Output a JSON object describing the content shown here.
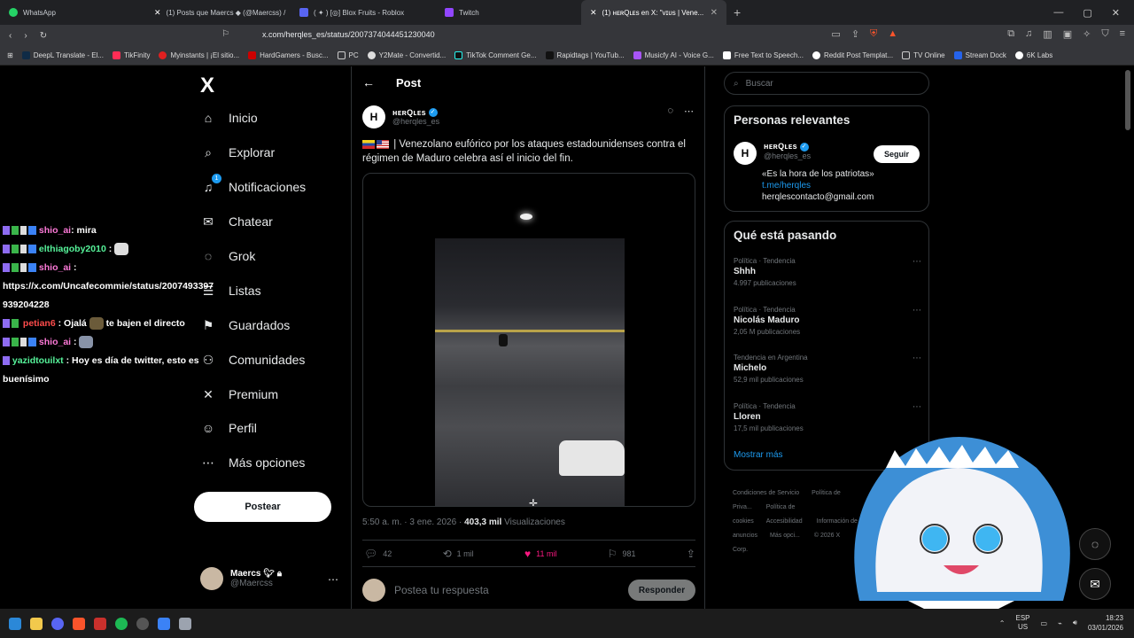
{
  "browser": {
    "tabs": [
      {
        "label": "WhatsApp",
        "color": "#25d366"
      },
      {
        "label": "(1) Posts que Maercs ◆ (@Maercss) /",
        "color": "#ffffff"
      },
      {
        "label": "( ✦ ) [◎] Blox Fruits - Roblox",
        "color": "#5865f2"
      },
      {
        "label": "Twitch",
        "color": "#9146ff"
      },
      {
        "label": "(1) ʜᴇʀQʟᴇs en X: \"vɪᴜs | Vene...",
        "color": "#ffffff"
      }
    ],
    "url": "x.com/herqles_es/status/2007374044451230040",
    "bookmarks": [
      "DeepL Translate - El...",
      "TikFinity",
      "Myinstants | ¡El sitio...",
      "HardGamers - Busc...",
      "PC",
      "Y2Mate - Convertid...",
      "TikTok Comment Ge...",
      "Rapidtags | YouTub...",
      "Musicfy AI - Voice G...",
      "Free Text to Speech...",
      "Reddit Post Templat...",
      "TV Online",
      "Stream Dock",
      "6K Labs"
    ]
  },
  "nav": {
    "logo": "X",
    "items": [
      {
        "label": "Inicio",
        "icon": "home-icon",
        "glyph": "⌂"
      },
      {
        "label": "Explorar",
        "icon": "search-icon",
        "glyph": "⌕"
      },
      {
        "label": "Notificaciones",
        "icon": "bell-icon",
        "glyph": "🔔︎",
        "badge": "1"
      },
      {
        "label": "Chatear",
        "icon": "mail-icon",
        "glyph": "✉"
      },
      {
        "label": "Grok",
        "icon": "grok-icon",
        "glyph": "◌"
      },
      {
        "label": "Listas",
        "icon": "list-icon",
        "glyph": "☰"
      },
      {
        "label": "Guardados",
        "icon": "bookmark-icon",
        "glyph": "⚑"
      },
      {
        "label": "Comunidades",
        "icon": "community-icon",
        "glyph": "⚇"
      },
      {
        "label": "Premium",
        "icon": "premium-icon",
        "glyph": "✕"
      },
      {
        "label": "Perfil",
        "icon": "profile-icon",
        "glyph": "☺"
      },
      {
        "label": "Más opciones",
        "icon": "more-icon",
        "glyph": "⋯"
      }
    ],
    "post_button": "Postear",
    "profile": {
      "name": "Maercs",
      "handle": "@Maercss"
    }
  },
  "chat": [
    {
      "user": "shio_ai",
      "color": "pink",
      "msg": ": mira"
    },
    {
      "user": "elthiagoby2010",
      "color": "green",
      "msg": ":"
    },
    {
      "user": "shio_ai",
      "color": "pink",
      "msg": ":"
    },
    {
      "user": "",
      "color": "",
      "msg": "https://x.com/Uncafecommie/status/2007493397939204228"
    },
    {
      "user": "petian6",
      "color": "red",
      "msg": ": Ojalá",
      "msg2": "te bajen el directo"
    },
    {
      "user": "shio_ai",
      "color": "pink",
      "msg": ":"
    },
    {
      "user": "yazidtouilxt",
      "color": "green",
      "msg": ": Hoy es día de twitter, esto es buenísimo"
    }
  ],
  "post": {
    "header": "Post",
    "author_name": "ʜᴇʀQʟᴇs",
    "author_handle": "@herqles_es",
    "text": "| Venezolano eufórico por los ataques estadounidenses contra el régimen de Maduro celebra así el inicio del fin.",
    "time": "5:50 a. m. · 3 ene. 2026 ·",
    "views_count": "403,3 mil",
    "views_label": "Visualizaciones",
    "replies": "42",
    "reposts": "1 mil",
    "likes": "11 mil",
    "bookmarks": "981",
    "reply_placeholder": "Postea tu respuesta",
    "reply_button": "Responder"
  },
  "sidebar": {
    "search_placeholder": "Buscar",
    "relevant_title": "Personas relevantes",
    "relevant": {
      "name": "ʜᴇʀQʟᴇs",
      "handle": "@herqles_es",
      "follow": "Seguir",
      "bio": "«Es la hora de los patriotas»",
      "link": "t.me/herqles",
      "email": "herqlescontacto@gmail.com"
    },
    "trending_title": "Qué está pasando",
    "trends": [
      {
        "category": "Política · Tendencia",
        "title": "Shhh",
        "count": "4.997 publicaciones"
      },
      {
        "category": "Política · Tendencia",
        "title": "Nicolás Maduro",
        "count": "2,05 M publicaciones"
      },
      {
        "category": "Tendencia en Argentina",
        "title": "Michelo",
        "count": "52,9 mil publicaciones"
      },
      {
        "category": "Política · Tendencia",
        "title": "Lloren",
        "count": "17,5 mil publicaciones"
      }
    ],
    "show_more": "Mostrar más",
    "footer": [
      "Condiciones de Servicio",
      "Política de Priva...",
      "Política de cookies",
      "Accesibilidad",
      "Información de anuncios",
      "Más opci...",
      "© 2026 X Corp."
    ]
  },
  "taskbar": {
    "lang1": "ESP",
    "lang2": "US",
    "time": "18:23",
    "date": "03/01/2026"
  },
  "colors": {
    "accent": "#1d9bf0",
    "like": "#f91880"
  }
}
